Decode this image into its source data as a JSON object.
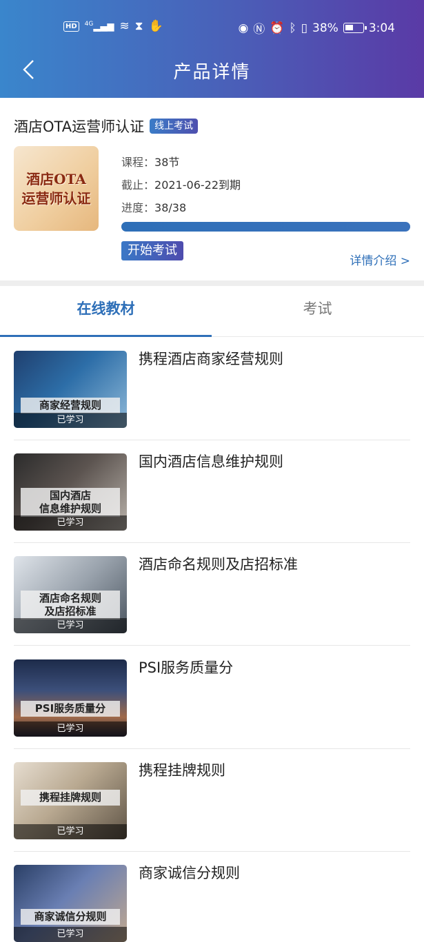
{
  "status_bar": {
    "left_chip": "HD",
    "network": "4G",
    "time": "3:04",
    "battery": "38%"
  },
  "nav": {
    "title": "产品详情"
  },
  "product": {
    "name": "酒店OTA运营师认证",
    "badge": "线上考试",
    "thumb_line1": "酒店OTA",
    "thumb_line2": "运营师认证",
    "course_label": "课程：",
    "course_value": "38节",
    "deadline_label": "截止：",
    "deadline_value": "2021-06-22到期",
    "progress_label": "进度：",
    "progress_value": "38/38",
    "progress_fraction": 1.0,
    "start_exam": "开始考试",
    "detail_link": "详情介绍 >"
  },
  "tabs": [
    {
      "label": "在线教材",
      "active": true
    },
    {
      "label": "考试",
      "active": false
    }
  ],
  "materials": [
    {
      "title": "携程酒店商家经营规则",
      "thumb_text": "商家经营规则",
      "status": "已学习"
    },
    {
      "title": "国内酒店信息维护规则",
      "thumb_text": "国内酒店\n信息维护规则",
      "status": "已学习"
    },
    {
      "title": "酒店命名规则及店招标准",
      "thumb_text": "酒店命名规则\n及店招标准",
      "status": "已学习"
    },
    {
      "title": "PSI服务质量分",
      "thumb_text": "PSI服务质量分",
      "status": "已学习"
    },
    {
      "title": "携程挂牌规则",
      "thumb_text": "携程挂牌规则",
      "status": "已学习"
    },
    {
      "title": "商家诚信分规则",
      "thumb_text": "商家诚信分规则",
      "status": "已学习"
    }
  ],
  "colors": {
    "accent": "#2e6fb8",
    "header_start": "#3a86cc",
    "header_end": "#5a3aa6"
  }
}
